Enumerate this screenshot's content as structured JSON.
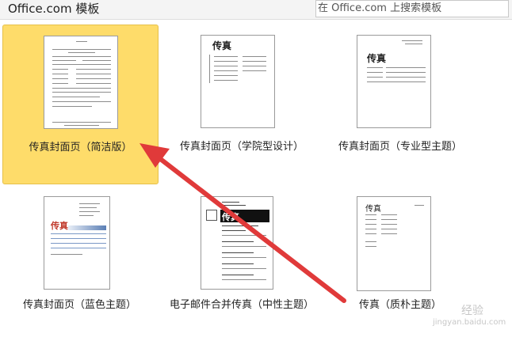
{
  "header": {
    "title": "Office.com 模板",
    "search_placeholder": "在 Office.com 上搜索模板"
  },
  "templates": [
    {
      "label": "传真封面页（简洁版）",
      "selected": true
    },
    {
      "label": "传真封面页（学院型设计）",
      "selected": false,
      "thumb_title": "传真"
    },
    {
      "label": "传真封面页（专业型主题）",
      "selected": false,
      "thumb_title": "传真"
    },
    {
      "label": "传真封面页（蓝色主题）",
      "selected": false,
      "thumb_title": "传真"
    },
    {
      "label": "电子邮件合并传真（中性主题）",
      "selected": false,
      "thumb_title": "传真"
    },
    {
      "label": "传真（质朴主题）",
      "selected": false,
      "thumb_title": "传真"
    }
  ],
  "colors": {
    "selected_fill": "#fedc6a",
    "arrow": "#e03a3a",
    "blue_theme": "#5b7fb5"
  },
  "watermark": {
    "line1": "经验",
    "line2": "jingyan.baidu.com"
  }
}
